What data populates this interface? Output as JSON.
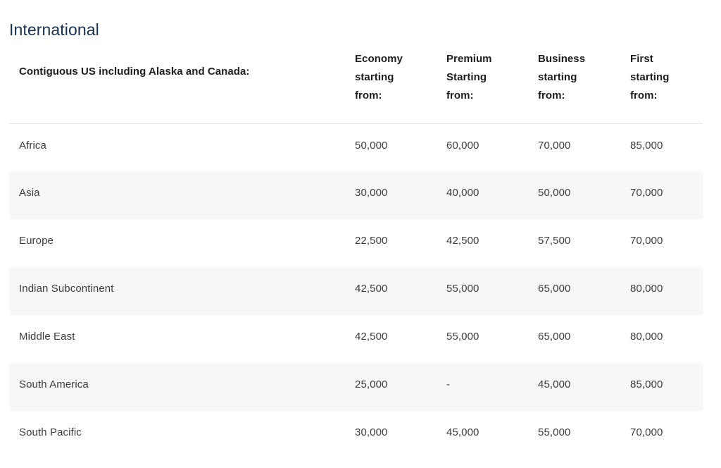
{
  "section": {
    "title": "International"
  },
  "table": {
    "region_header": "Contiguous US including Alaska and Canada:",
    "columns": [
      {
        "key": "economy",
        "lines": [
          "Economy",
          "starting",
          "from:"
        ]
      },
      {
        "key": "premium",
        "lines": [
          "Premium",
          "Starting",
          "from:"
        ]
      },
      {
        "key": "business",
        "lines": [
          "Business",
          "starting",
          "from:"
        ]
      },
      {
        "key": "first",
        "lines": [
          "First",
          "starting",
          "from:"
        ]
      }
    ],
    "rows": [
      {
        "region": "Africa",
        "economy": "50,000",
        "premium": "60,000",
        "business": "70,000",
        "first": "85,000",
        "striped": false
      },
      {
        "region": "Asia",
        "economy": "30,000",
        "premium": "40,000",
        "business": "50,000",
        "first": "70,000",
        "striped": true
      },
      {
        "region": "Europe",
        "economy": "22,500",
        "premium": "42,500",
        "business": "57,500",
        "first": "70,000",
        "striped": false
      },
      {
        "region": "Indian Subcontinent",
        "economy": "42,500",
        "premium": "55,000",
        "business": "65,000",
        "first": "80,000",
        "striped": true
      },
      {
        "region": "Middle East",
        "economy": "42,500",
        "premium": "55,000",
        "business": "65,000",
        "first": "80,000",
        "striped": false
      },
      {
        "region": "South America",
        "economy": "25,000",
        "premium": "-",
        "business": "45,000",
        "first": "85,000",
        "striped": true
      },
      {
        "region": "South Pacific",
        "economy": "30,000",
        "premium": "45,000",
        "business": "55,000",
        "first": "70,000",
        "striped": false
      }
    ]
  },
  "colors": {
    "title": "#16314f",
    "header_text": "#1d1d1d",
    "body_text": "#3c3c3c",
    "stripe": "#f7f7f7",
    "rule": "#e4e6e8",
    "background": "#ffffff"
  }
}
